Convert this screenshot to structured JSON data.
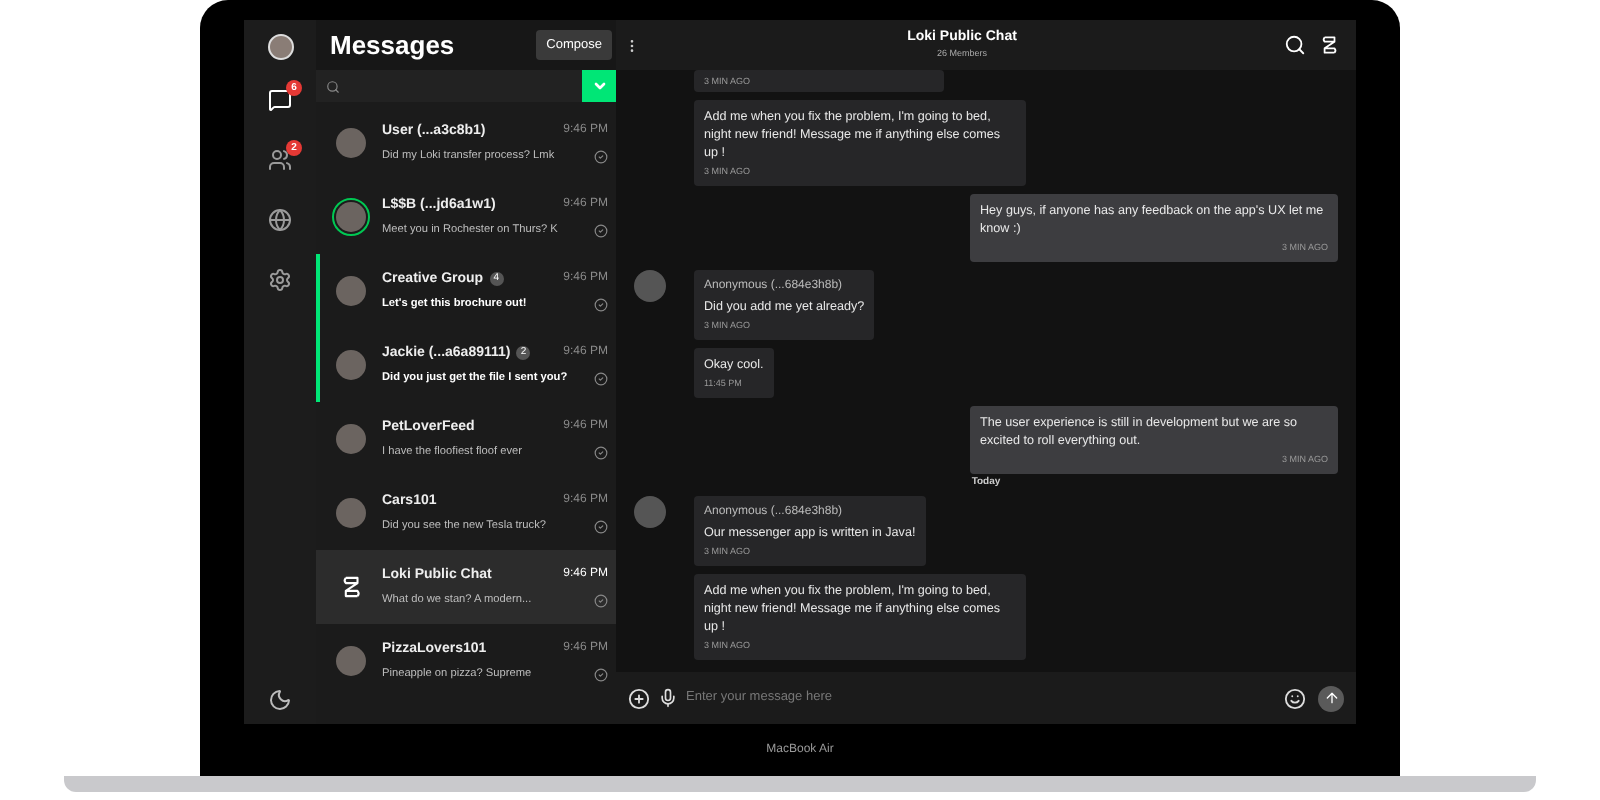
{
  "device": {
    "label": "MacBook Air"
  },
  "rail": {
    "items": [
      {
        "badge": "6",
        "selected": true
      },
      {
        "badge": "2",
        "selected": false
      },
      {
        "selected": false
      },
      {
        "selected": false
      }
    ]
  },
  "list": {
    "title": "Messages",
    "compose": "Compose",
    "conversations": [
      {
        "name": "User (...a3c8b1)",
        "preview": "Did my Loki transfer process? Lmk",
        "time": "9:46 PM",
        "unread": false,
        "selected": false,
        "online": false,
        "kind": "photo"
      },
      {
        "name": "L$$B (...jd6a1w1)",
        "preview": "Meet you in Rochester on Thurs? K",
        "time": "9:46 PM",
        "unread": false,
        "selected": false,
        "online": true,
        "kind": "photo"
      },
      {
        "name": "Creative Group",
        "badge": "4",
        "preview": "Let's get this brochure out!",
        "time": "9:46 PM",
        "unread": true,
        "selected": false,
        "online": false,
        "kind": "photo"
      },
      {
        "name": "Jackie (...a6a89111)",
        "badge": "2",
        "preview": "Did you just get the file I sent you?",
        "time": "9:46 PM",
        "unread": true,
        "selected": false,
        "online": false,
        "kind": "photo"
      },
      {
        "name": "PetLoverFeed",
        "preview": "I have the floofiest floof ever",
        "time": "9:46 PM",
        "unread": false,
        "selected": false,
        "online": false,
        "kind": "photo"
      },
      {
        "name": "Cars101",
        "preview": "Did you see the new Tesla truck?",
        "time": "9:46 PM",
        "unread": false,
        "selected": false,
        "online": false,
        "kind": "photo"
      },
      {
        "name": "Loki Public Chat",
        "preview": "What do we stan? A modern...",
        "time": "9:46 PM",
        "unread": false,
        "selected": true,
        "online": false,
        "kind": "logo"
      },
      {
        "name": "PizzaLovers101",
        "preview": "Pineapple on pizza? Supreme",
        "time": "9:46 PM",
        "unread": false,
        "selected": false,
        "online": false,
        "kind": "photo"
      }
    ]
  },
  "chat": {
    "title": "Loki Public Chat",
    "subtitle": "26 Members",
    "messages": [
      {
        "kind": "incoming",
        "avatar": false,
        "time": "3 MIN AGO"
      },
      {
        "kind": "incoming",
        "avatar": false,
        "text": "Add me when you fix the problem, I'm going to bed, night new friend! Message me if anything else comes up !",
        "time": "3 MIN AGO"
      },
      {
        "kind": "outgoing",
        "text": "Hey guys, if anyone has any feedback on the app's UX let me know :)",
        "time": "3 MIN AGO"
      },
      {
        "kind": "incoming",
        "sender": "Anonymous (...684e3h8b)",
        "avatar": true,
        "text": "Did you add me yet already?",
        "time": "3 MIN AGO"
      },
      {
        "kind": "incoming",
        "avatar": false,
        "text": "Okay cool.",
        "time": "11:45 PM"
      },
      {
        "kind": "outgoing",
        "text": "The user experience is still in development but we are so excited to roll everything out.",
        "time": "3 MIN AGO"
      },
      {
        "kind": "divider",
        "text": "Today"
      },
      {
        "kind": "incoming",
        "sender": "Anonymous (...684e3h8b)",
        "avatar": true,
        "text": "Our messenger app is written in  Java!",
        "time": "3 MIN AGO"
      },
      {
        "kind": "incoming",
        "avatar": false,
        "text": "Add me when you fix the problem, I'm going to bed, night new friend! Message me if anything else comes up !",
        "time": "3 MIN AGO"
      }
    ],
    "input": {
      "placeholder": "Enter your message here"
    }
  }
}
